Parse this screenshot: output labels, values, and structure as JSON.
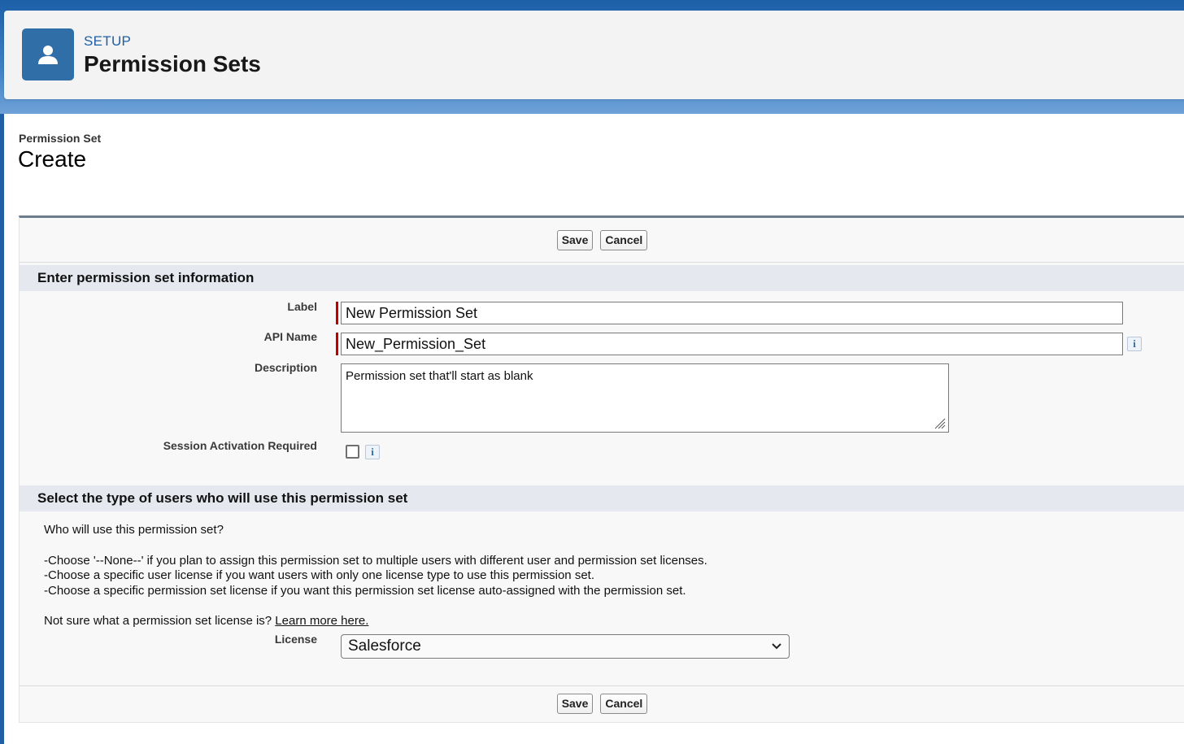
{
  "header": {
    "setup_label": "SETUP",
    "title": "Permission Sets",
    "icon": "user-icon"
  },
  "page": {
    "breadcrumb": "Permission Set",
    "title": "Create"
  },
  "buttons": {
    "save": "Save",
    "cancel": "Cancel"
  },
  "section1": {
    "heading": "Enter permission set information",
    "label_label": "Label",
    "label_value": "New Permission Set",
    "api_label": "API Name",
    "api_value": "New_Permission_Set",
    "description_label": "Description",
    "description_value": "Permission set that'll start as blank",
    "session_label": "Session Activation Required",
    "info_glyph": "i"
  },
  "section2": {
    "heading": "Select the type of users who will use this permission set",
    "question": "Who will use this permission set?",
    "line1": "-Choose '--None--' if you plan to assign this permission set to multiple users with different user and permission set licenses.",
    "line2": "-Choose a specific user license if you want users with only one license type to use this permission set.",
    "line3": "-Choose a specific permission set license if you want this permission set license auto-assigned with the permission set.",
    "not_sure": "Not sure what a permission set license is? ",
    "learn_more": "Learn more here.",
    "license_label": "License",
    "license_value": "Salesforce"
  },
  "colors": {
    "brand": "#1f5fa6",
    "required": "#c00000",
    "section_bg": "#e5e9ef"
  }
}
